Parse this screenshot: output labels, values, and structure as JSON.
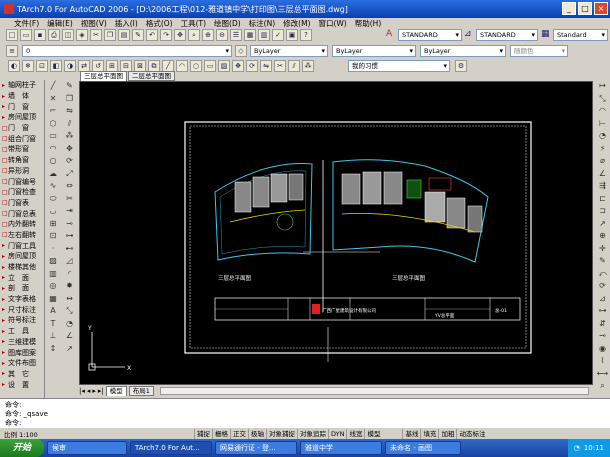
{
  "window": {
    "title": "TArch7.0 For AutoCAD 2006 - [D:\\2006工程\\012-雅道镇中学\\打印图\\三层总平面图.dwg]"
  },
  "menu": [
    "文件(F)",
    "编辑(E)",
    "视图(V)",
    "插入(I)",
    "格式(O)",
    "工具(T)",
    "绘图(D)",
    "标注(N)",
    "修改(M)",
    "窗口(W)",
    "帮助(H)"
  ],
  "toolbar": {
    "text_style": "STANDARD",
    "dim_style": "STANDARD",
    "table_style": "Standard",
    "layer_current": "0",
    "color": "ByLayer",
    "linetype": "ByLayer",
    "lineweight": "ByLayer",
    "plotstyle": "随颜色",
    "workspace": "我的习惯"
  },
  "left_panel": [
    "轴网柱子",
    "墙　体",
    "门　窗",
    "房间屋顶",
    "门　窗",
    "组合门窗",
    "带形窗",
    "转角窗",
    "异形洞",
    "门窗编号",
    "门窗检查",
    "门窗表",
    "门窗总表",
    "内外翻转",
    "左右翻转",
    "门窗工具",
    "房间屋顶",
    "楼梯其他",
    "立　面",
    "剖　面",
    "文字表格",
    "尺寸标注",
    "符号标注",
    "工　具",
    "三维建模",
    "图库图案",
    "文件布图",
    "其　它",
    "设　置"
  ],
  "doc_tabs": [
    "三层总平面图",
    "二层总平面图"
  ],
  "drawing": {
    "label_left": "三层总平面图",
    "label_right": "三层总平面图",
    "title_block_company": "广西广星建筑设计有限公司",
    "title_block_code": "总-01",
    "title_block_name": "YV总平面"
  },
  "layout_tabs": [
    "模型",
    "布局1"
  ],
  "command_lines": [
    "命令:",
    "命令: _qsave",
    "命令:"
  ],
  "status": {
    "scale": "比例 1:100",
    "toggles": [
      "捕捉",
      "栅格",
      "正交",
      "极轴",
      "对象捕捉",
      "对象追踪",
      "DYN",
      "线宽",
      "模型",
      "基线",
      "填充",
      "加粗",
      "动态标注"
    ]
  },
  "taskbar": {
    "start": "开始",
    "tasks": [
      "候审",
      "TArch7.0 For Aut...",
      "网易通行证 - 登...",
      "雅道中学",
      "未命名 - 画图"
    ],
    "clock": "10:11"
  }
}
